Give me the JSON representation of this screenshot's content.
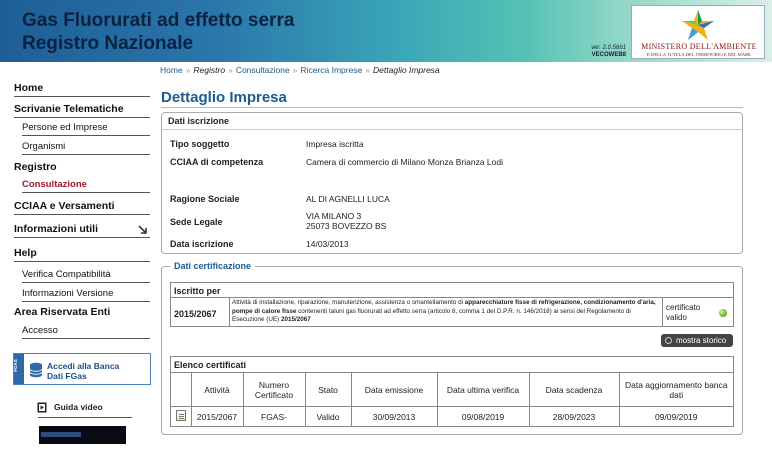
{
  "header": {
    "title_line1": "Gas Fluorurati ad effetto serra",
    "title_line2": "Registro Nazionale",
    "version": "ver. 2.0.5661",
    "build": "VECOWEB8",
    "ministry_line1": "MINISTERO DELL'AMBIENTE",
    "ministry_line2": "E DELLA TUTELA DEL TERRITORIO E DEL MARE"
  },
  "breadcrumb": {
    "home": "Home",
    "registro": "Registro",
    "consultazione": "Consultazione",
    "ricerca": "Ricerca Imprese",
    "current": "Dettaglio Impresa",
    "separator": "»"
  },
  "sidebar": {
    "home": "Home",
    "scrivanie": "Scrivanie Telematiche",
    "persone": "Persone ed Imprese",
    "organismi": "Organismi",
    "registro": "Registro",
    "consultazione": "Consultazione",
    "cciaa": "CCIAA e Versamenti",
    "info": "Informazioni utili",
    "help": "Help",
    "verifica": "Verifica Compatibilità",
    "info_versione": "Informazioni Versione",
    "area_riservata": "Area Riservata Enti",
    "accesso": "Accesso",
    "accedi_line1": "Accedi alla Banca",
    "accedi_line2": "Dati FGas",
    "accedi_side": "FGAS",
    "guida_video": "Guida video"
  },
  "page": {
    "title": "Dettaglio Impresa"
  },
  "dati_iscrizione": {
    "heading": "Dati iscrizione",
    "tipo_label": "Tipo soggetto",
    "tipo_value": "Impresa iscritta",
    "cciaa_label": "CCIAA di competenza",
    "cciaa_value": "Camera di commercio di Milano Monza Brianza Lodi",
    "ragione_label": "Ragione Sociale",
    "ragione_value": "AL DI AGNELLI LUCA",
    "sede_label": "Sede Legale",
    "sede_line1": "VIA MILANO 3",
    "sede_line2": "25073 BOVEZZO BS",
    "data_label": "Data iscrizione",
    "data_value": "14/03/2013"
  },
  "dati_certificazione": {
    "legend": "Dati certificazione",
    "iscritto_head": "Iscritto per",
    "code": "2015/2067",
    "desc_a": "Attività di installazione, riparazione, manutenzione, assistenza o smantellamento di ",
    "desc_b": "apparecchiature fisse di refrigerazione, condizionamento d'aria, pompe di calore fisse",
    "desc_c": " contenenti taluni gas fluorurati ad effetto serra (articolo 8, comma 1 del D.P.R. n. 146/2018) ai sensi del Regolamento di Esecuzione (UE) ",
    "desc_d": "2015/2067",
    "status_line1": "certificato",
    "status_line2": "valido",
    "status_color": "#5aa81c",
    "storico_button": "mostra storico"
  },
  "elenco": {
    "heading": "Elenco certificati",
    "columns": [
      "",
      "Attività",
      "Numero Certificato",
      "Stato",
      "Data emissione",
      "Data ultima verifica",
      "Data scadenza",
      "Data aggiornamento banca dati"
    ],
    "rows": [
      [
        "",
        "2015/2067",
        "FGAS-",
        "Valido",
        "30/09/2013",
        "09/08/2019",
        "28/09/2023",
        "09/09/2019"
      ]
    ]
  },
  "colors": {
    "brand_blue": "#1d5c8e",
    "active_red": "#9b1b2a"
  }
}
